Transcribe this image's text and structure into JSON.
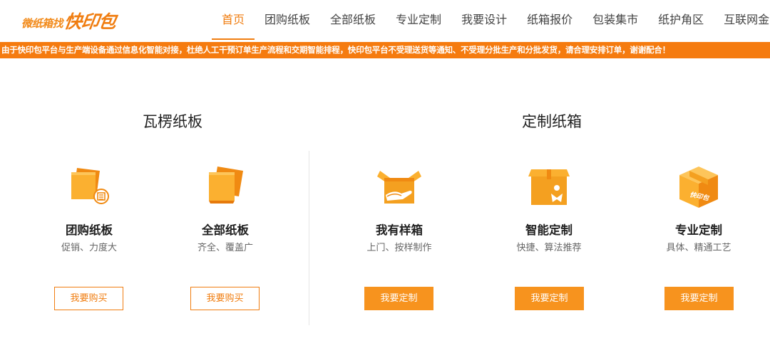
{
  "brand": {
    "slogan": "微纸箱找",
    "name": "快印包"
  },
  "nav": {
    "items": [
      {
        "label": "首页"
      },
      {
        "label": "团购纸板"
      },
      {
        "label": "全部纸板"
      },
      {
        "label": "专业定制"
      },
      {
        "label": "我要设计"
      },
      {
        "label": "纸箱报价"
      },
      {
        "label": "包装集市"
      },
      {
        "label": "纸护角区"
      },
      {
        "label": "互联网金融"
      }
    ],
    "active_index": 0
  },
  "notice": {
    "text": "由于快印包平台与生产端设备通过信息化智能对接，杜绝人工干预订单生产流程和交期智能排程，快印包平台不受理送货等通知、不受理分批生产和分批发货，请合理安排订单，谢谢配合！"
  },
  "sections": {
    "corrugated": {
      "title": "瓦楞纸板"
    },
    "custom": {
      "title": "定制纸箱"
    }
  },
  "cards": [
    {
      "title": "团购纸板",
      "subtitle": "促销、力度大",
      "button": "我要购买",
      "icon": "board-group-icon"
    },
    {
      "title": "全部纸板",
      "subtitle": "齐全、覆盖广",
      "button": "我要购买",
      "icon": "board-stack-icon"
    },
    {
      "title": "我有样箱",
      "subtitle": "上门、按样制作",
      "button": "我要定制",
      "icon": "open-box-hand-icon"
    },
    {
      "title": "智能定制",
      "subtitle": "快捷、算法推荐",
      "button": "我要定制",
      "icon": "box-person-icon"
    },
    {
      "title": "专业定制",
      "subtitle": "具体、精通工艺",
      "button": "我要定制",
      "icon": "branded-cube-box-icon"
    }
  ],
  "icon_logo_text": "快印包",
  "colors": {
    "accent": "#f07d10",
    "notice_bg": "#f57b0f",
    "button_solid": "#f7931e",
    "icon_light": "#fbb030",
    "icon_dark": "#f08a12"
  }
}
